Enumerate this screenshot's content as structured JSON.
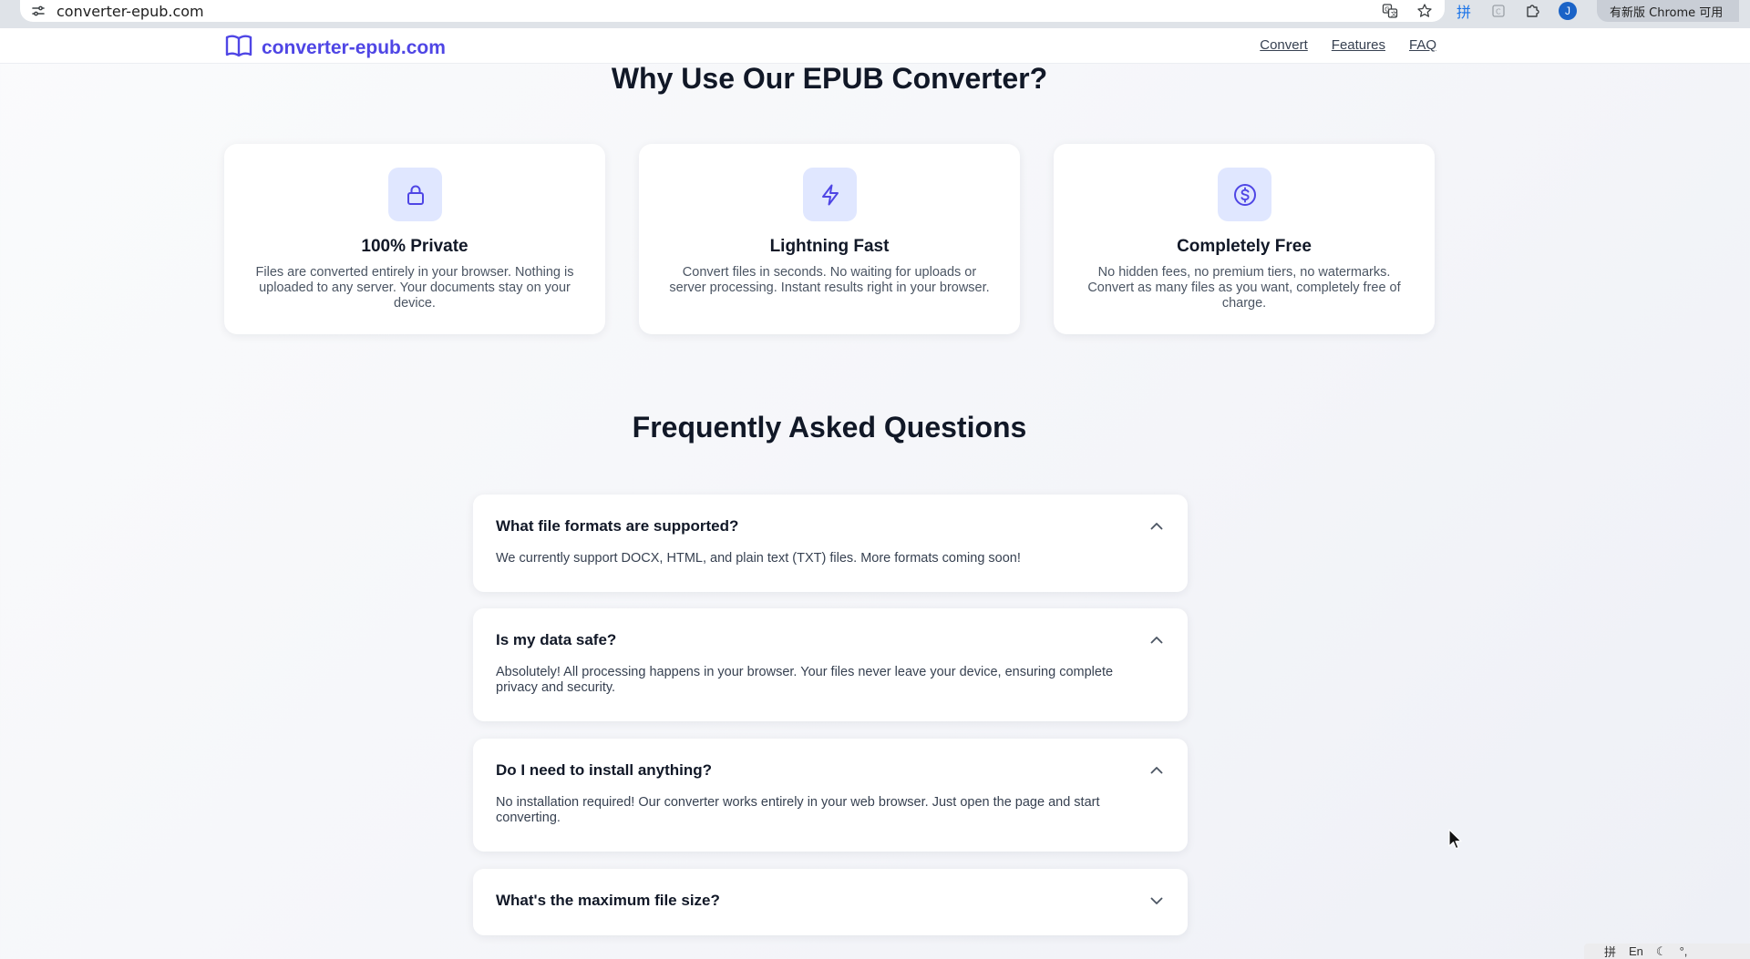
{
  "browser": {
    "url": "converter-epub.com",
    "update_label": "有新版 Chrome 可用",
    "profile_initial": "J",
    "icons": [
      "site-info-icon",
      "translate-icon",
      "star-icon",
      "ime-icon",
      "extension-c-icon",
      "puzzle-icon"
    ]
  },
  "header": {
    "brand": "converter-epub.com",
    "nav": {
      "convert": "Convert",
      "features": "Features",
      "faq": "FAQ"
    }
  },
  "features": {
    "title": "Why Use Our EPUB Converter?",
    "items": [
      {
        "icon": "lock-icon",
        "title": "100% Private",
        "desc": "Files are converted entirely in your browser. Nothing is uploaded to any server. Your documents stay on your device."
      },
      {
        "icon": "lightning-icon",
        "title": "Lightning Fast",
        "desc": "Convert files in seconds. No waiting for uploads or server processing. Instant results right in your browser."
      },
      {
        "icon": "dollar-icon",
        "title": "Completely Free",
        "desc": "No hidden fees, no premium tiers, no watermarks. Convert as many files as you want, completely free of charge."
      }
    ]
  },
  "faq": {
    "title": "Frequently Asked Questions",
    "items": [
      {
        "question": "What file formats are supported?",
        "answer": "We currently support DOCX, HTML, and plain text (TXT) files. More formats coming soon!",
        "expanded": true
      },
      {
        "question": "Is my data safe?",
        "answer": "Absolutely! All processing happens in your browser. Your files never leave your device, ensuring complete privacy and security.",
        "expanded": true
      },
      {
        "question": "Do I need to install anything?",
        "answer": "No installation required! Our converter works entirely in your web browser. Just open the page and start converting.",
        "expanded": true
      },
      {
        "question": "What's the maximum file size?",
        "answer": "",
        "expanded": false
      }
    ]
  },
  "tray": {
    "lang": "En"
  },
  "colors": {
    "brand": "#4f46e5",
    "icon_bg": "#e0e7ff"
  }
}
